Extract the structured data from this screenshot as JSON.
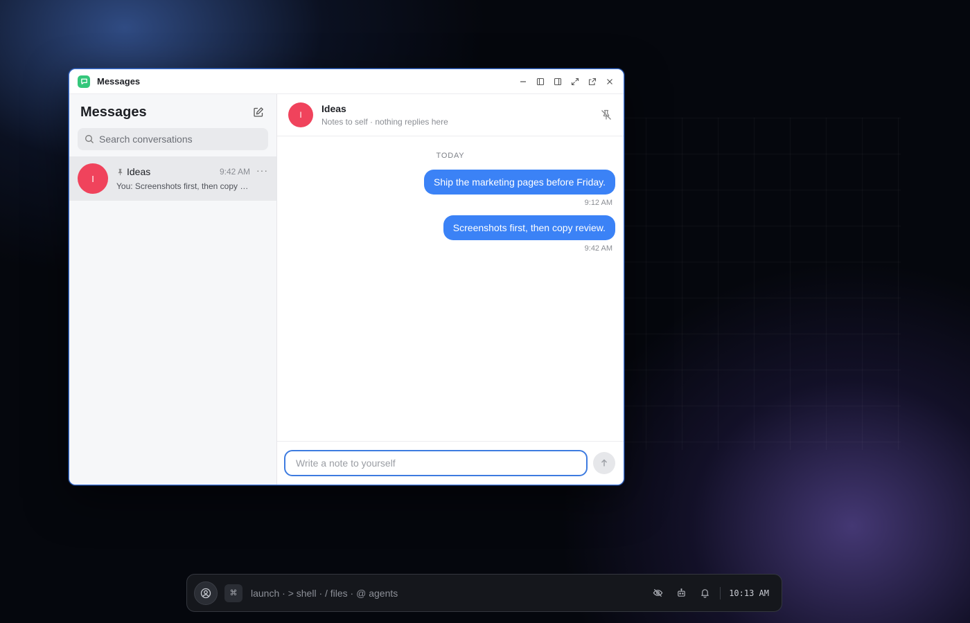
{
  "window": {
    "title": "Messages"
  },
  "sidebar": {
    "title": "Messages",
    "search_placeholder": "Search conversations",
    "conversations": [
      {
        "initial": "I",
        "name": "Ideas",
        "pinned": true,
        "time": "9:42 AM",
        "preview": "You: Screenshots first, then copy review.",
        "avatar_color": "#f0435c"
      }
    ]
  },
  "chat": {
    "initial": "I",
    "name": "Ideas",
    "subtitle": "Notes to self · nothing replies here",
    "day_label": "TODAY",
    "messages": [
      {
        "text": "Ship the marketing pages before Friday.",
        "time": "9:12 AM"
      },
      {
        "text": "Screenshots first, then copy review.",
        "time": "9:42 AM"
      }
    ],
    "input_placeholder": "Write a note to yourself"
  },
  "taskbar": {
    "cmd_symbol": "⌘",
    "launcher_text": "launch · > shell · / files · @ agents",
    "clock": "10:13 AM"
  },
  "colors": {
    "accent": "#3b82f6",
    "avatar": "#f0435c",
    "app_icon": "#34c77b"
  }
}
